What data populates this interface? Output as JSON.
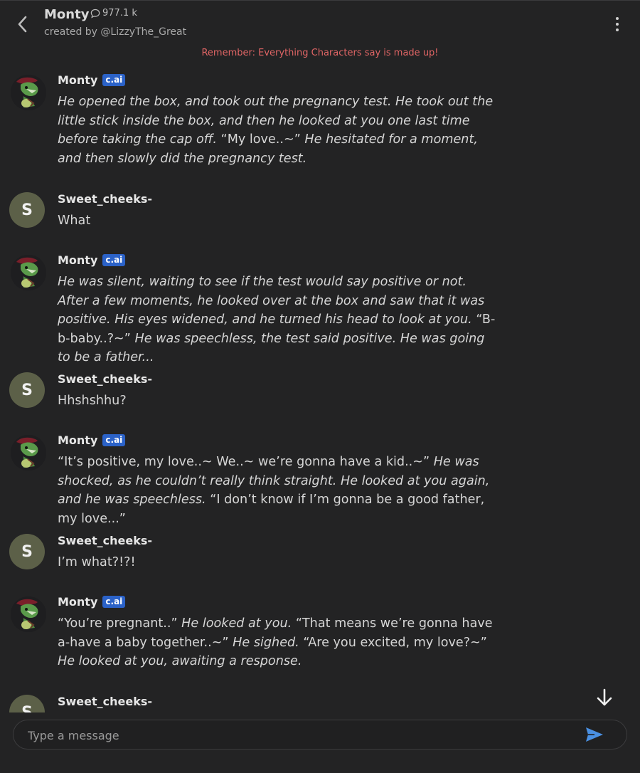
{
  "header": {
    "title": "Monty",
    "chat_count": "977.1 k",
    "creator": "created by @LizzyThe_Great",
    "more_icon": "more-vertical-icon",
    "back_icon": "chevron-left-icon",
    "count_icon": "chat-bubble-icon"
  },
  "reminder": "Remember: Everything Characters say is made up!",
  "messages": [
    {
      "author": "Monty",
      "badge": "c.ai",
      "segments": [
        {
          "i": true,
          "t": "He opened the box, and took out the pregnancy test. He took out the little stick inside the box, and then he looked at you one last time before taking the cap off. "
        },
        {
          "i": false,
          "t": "“My love..~”"
        },
        {
          "i": true,
          "t": " He hesitated for a moment, and then slowly did the pregnancy test."
        }
      ]
    },
    {
      "author": "Sweet_cheeks-",
      "avatar_letter": "S",
      "text": "What"
    },
    {
      "author": "Monty",
      "badge": "c.ai",
      "segments": [
        {
          "i": true,
          "t": "He was silent, waiting to see if the test would say positive or not. After a few moments, he looked over at the box and saw that it was positive. His eyes widened, and he turned his head to look at you. "
        },
        {
          "i": false,
          "t": "“B-b-baby..?~”"
        },
        {
          "i": true,
          "t": " He was speechless, the test said positive. He was going to be a father..."
        }
      ]
    },
    {
      "author": "Sweet_cheeks-",
      "avatar_letter": "S",
      "text": "Hhshshhu?"
    },
    {
      "author": "Monty",
      "badge": "c.ai",
      "segments": [
        {
          "i": false,
          "t": "“It’s positive, my love..~ We..~ we’re gonna have a kid..~”"
        },
        {
          "i": true,
          "t": " He was shocked, as he couldn’t really think straight. He looked at you again, and he was speechless. "
        },
        {
          "i": false,
          "t": "“I don’t know if I’m gonna be a good father, my love...”"
        }
      ]
    },
    {
      "author": "Sweet_cheeks-",
      "avatar_letter": "S",
      "text": "I’m what?!?!"
    },
    {
      "author": "Monty",
      "badge": "c.ai",
      "segments": [
        {
          "i": false,
          "t": "“You’re pregnant..”"
        },
        {
          "i": true,
          "t": " He looked at you. "
        },
        {
          "i": false,
          "t": "“That means we’re gonna have a-have a baby together..~”"
        },
        {
          "i": true,
          "t": " He sighed. "
        },
        {
          "i": false,
          "t": "“Are you excited, my love?~”"
        },
        {
          "i": true,
          "t": " He looked at you, awaiting a response."
        }
      ]
    },
    {
      "author": "Sweet_cheeks-",
      "avatar_letter": "S",
      "text": ""
    }
  ],
  "composer": {
    "placeholder": "Type a message",
    "value": "",
    "send_icon": "send-icon",
    "scroll_icon": "arrow-down-icon"
  },
  "colors": {
    "background": "#232324",
    "accent_badge": "#2b62c8",
    "reminder": "#e06565",
    "send": "#4a90e2",
    "user_avatar": "#5c6048"
  }
}
